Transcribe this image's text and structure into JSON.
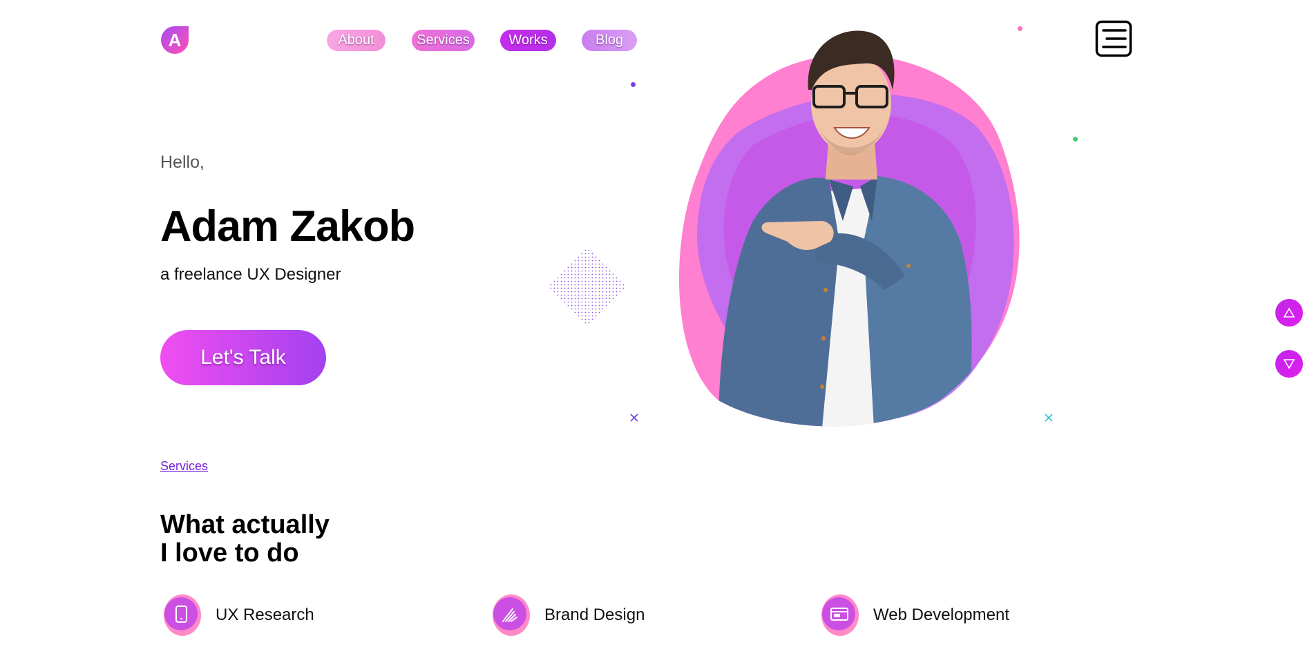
{
  "logo": {
    "letter": "A"
  },
  "nav": {
    "items": [
      {
        "label": "About"
      },
      {
        "label": "Services"
      },
      {
        "label": "Works"
      },
      {
        "label": "Blog"
      }
    ]
  },
  "hero": {
    "greeting": "Hello,",
    "name": "Adam Zakob",
    "subtitle": "a freelance UX Designer",
    "cta_label": "Let's Talk"
  },
  "services": {
    "link_label": "Services",
    "title_line1": "What actually",
    "title_line2": "I love to do",
    "items": [
      {
        "label": "UX Research",
        "icon": "mobile-icon"
      },
      {
        "label": "Brand Design",
        "icon": "brand-icon"
      },
      {
        "label": "Web Development",
        "icon": "browser-icon"
      }
    ]
  },
  "colors": {
    "accent_pink": "#f04ef0",
    "accent_purple": "#a341ef",
    "blob_pink": "#ff7fd0",
    "blob_purple": "#b86af5"
  }
}
